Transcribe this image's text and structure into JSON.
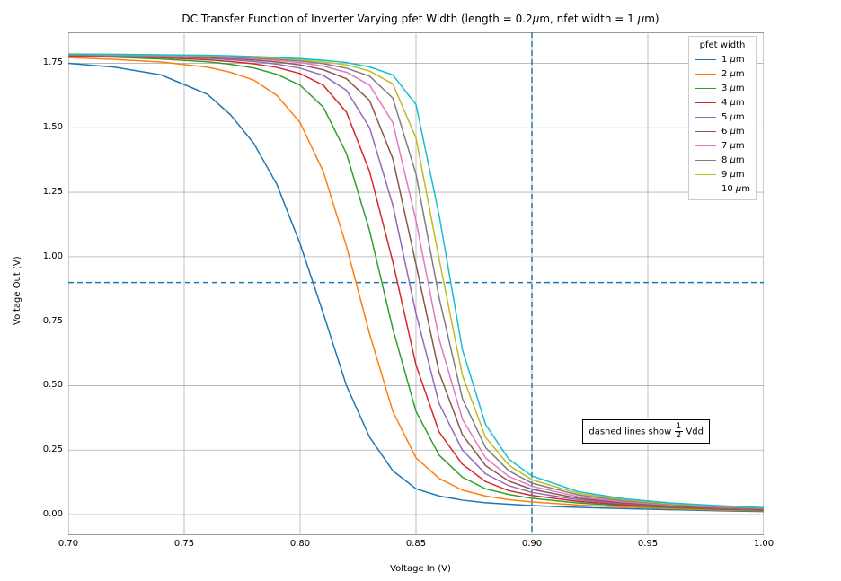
{
  "chart_data": {
    "type": "line",
    "title": "DC Transfer Function of Inverter Varying pfet Width (length = 0.2μm, nfet width = 1 μm)",
    "xlabel": "Voltage In (V)",
    "ylabel": "Voltage Out (V)",
    "xlim": [
      0.7,
      1.0
    ],
    "ylim": [
      -0.08,
      1.87
    ],
    "xticks": [
      0.7,
      0.75,
      0.8,
      0.85,
      0.9,
      0.95,
      1.0
    ],
    "yticks": [
      0.0,
      0.25,
      0.5,
      0.75,
      1.0,
      1.25,
      1.5,
      1.75
    ],
    "legend_title": "pfet width",
    "annotation": "dashed lines show ½ Vdd",
    "reference_lines": {
      "hline_y": 0.9,
      "vline_x": 0.9
    },
    "x": [
      0.7,
      0.72,
      0.74,
      0.76,
      0.77,
      0.78,
      0.79,
      0.8,
      0.81,
      0.82,
      0.83,
      0.84,
      0.85,
      0.86,
      0.87,
      0.88,
      0.89,
      0.9,
      0.92,
      0.94,
      0.96,
      0.98,
      1.0
    ],
    "series": [
      {
        "name": "1 μm",
        "color": "#1f77b4",
        "values": [
          1.75,
          1.735,
          1.705,
          1.63,
          1.55,
          1.44,
          1.28,
          1.05,
          0.78,
          0.5,
          0.3,
          0.17,
          0.1,
          0.072,
          0.056,
          0.046,
          0.04,
          0.035,
          0.028,
          0.023,
          0.019,
          0.015,
          0.012
        ]
      },
      {
        "name": "2 μm",
        "color": "#ff7f0e",
        "values": [
          1.772,
          1.765,
          1.755,
          1.735,
          1.715,
          1.685,
          1.625,
          1.52,
          1.33,
          1.04,
          0.7,
          0.4,
          0.22,
          0.14,
          0.095,
          0.072,
          0.058,
          0.049,
          0.037,
          0.029,
          0.023,
          0.018,
          0.015
        ]
      },
      {
        "name": "3 μm",
        "color": "#2ca02c",
        "values": [
          1.778,
          1.774,
          1.767,
          1.756,
          1.746,
          1.732,
          1.707,
          1.665,
          1.58,
          1.4,
          1.1,
          0.72,
          0.4,
          0.23,
          0.145,
          0.1,
          0.078,
          0.063,
          0.045,
          0.034,
          0.027,
          0.021,
          0.017
        ]
      },
      {
        "name": "4 μm",
        "color": "#d62728",
        "values": [
          1.78,
          1.777,
          1.772,
          1.764,
          1.757,
          1.748,
          1.734,
          1.71,
          1.665,
          1.56,
          1.33,
          0.98,
          0.58,
          0.32,
          0.195,
          0.128,
          0.093,
          0.074,
          0.051,
          0.038,
          0.03,
          0.023,
          0.019
        ]
      },
      {
        "name": "5 μm",
        "color": "#9467bd",
        "values": [
          1.782,
          1.779,
          1.775,
          1.77,
          1.764,
          1.757,
          1.747,
          1.731,
          1.703,
          1.645,
          1.5,
          1.2,
          0.78,
          0.43,
          0.25,
          0.158,
          0.112,
          0.086,
          0.057,
          0.042,
          0.032,
          0.025,
          0.02
        ]
      },
      {
        "name": "6 μm",
        "color": "#8c564b",
        "values": [
          1.783,
          1.781,
          1.778,
          1.773,
          1.769,
          1.763,
          1.755,
          1.744,
          1.725,
          1.69,
          1.605,
          1.38,
          0.97,
          0.55,
          0.31,
          0.19,
          0.13,
          0.098,
          0.063,
          0.045,
          0.034,
          0.027,
          0.021
        ]
      },
      {
        "name": "7 μm",
        "color": "#e377c2",
        "values": [
          1.784,
          1.782,
          1.779,
          1.776,
          1.772,
          1.768,
          1.761,
          1.753,
          1.739,
          1.715,
          1.665,
          1.52,
          1.14,
          0.68,
          0.37,
          0.22,
          0.148,
          0.11,
          0.069,
          0.049,
          0.037,
          0.029,
          0.023
        ]
      },
      {
        "name": "8 μm",
        "color": "#7f7f7f",
        "values": [
          1.785,
          1.783,
          1.781,
          1.778,
          1.775,
          1.771,
          1.766,
          1.759,
          1.749,
          1.731,
          1.7,
          1.615,
          1.32,
          0.84,
          0.45,
          0.26,
          0.17,
          0.122,
          0.076,
          0.053,
          0.04,
          0.031,
          0.024
        ]
      },
      {
        "name": "9 μm",
        "color": "#bcbd22",
        "values": [
          1.786,
          1.784,
          1.782,
          1.779,
          1.777,
          1.774,
          1.77,
          1.764,
          1.756,
          1.744,
          1.72,
          1.67,
          1.46,
          0.99,
          0.54,
          0.3,
          0.192,
          0.135,
          0.082,
          0.057,
          0.042,
          0.033,
          0.026
        ]
      },
      {
        "name": "10 μm",
        "color": "#17becf",
        "values": [
          1.786,
          1.785,
          1.783,
          1.781,
          1.779,
          1.776,
          1.773,
          1.768,
          1.762,
          1.753,
          1.736,
          1.705,
          1.59,
          1.16,
          0.64,
          0.35,
          0.215,
          0.15,
          0.089,
          0.061,
          0.045,
          0.035,
          0.027
        ]
      }
    ]
  }
}
